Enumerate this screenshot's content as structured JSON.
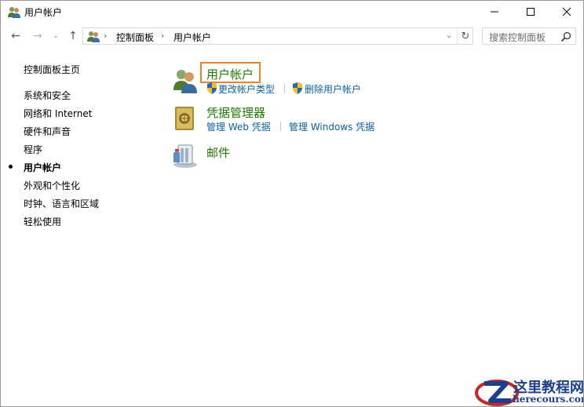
{
  "window": {
    "title": "用户帐户",
    "controls": {
      "minimize": "—",
      "maximize": "☐",
      "close": "✕"
    }
  },
  "nav": {
    "back": "←",
    "forward": "→",
    "recent": "⌄",
    "up": "↑"
  },
  "address": {
    "crumbs": [
      "控制面板",
      "用户帐户"
    ],
    "separator": "›",
    "dropdown": "⌄",
    "refresh": "↻"
  },
  "search": {
    "placeholder": "搜索控制面板"
  },
  "sidebar": {
    "home": "控制面板主页",
    "items": [
      {
        "label": "系统和安全"
      },
      {
        "label": "网络和 Internet"
      },
      {
        "label": "硬件和声音"
      },
      {
        "label": "程序"
      },
      {
        "label": "用户帐户",
        "active": true
      },
      {
        "label": "外观和个性化"
      },
      {
        "label": "时钟、语言和区域"
      },
      {
        "label": "轻松使用"
      }
    ]
  },
  "main": {
    "categories": [
      {
        "title": "用户帐户",
        "icon": "users-icon",
        "links": [
          "更改帐户类型",
          "删除用户帐户"
        ]
      },
      {
        "title": "凭据管理器",
        "icon": "vault-icon",
        "links": [
          "管理 Web 凭据",
          "管理 Windows 凭据"
        ]
      },
      {
        "title": "邮件",
        "icon": "mail-icon",
        "links": []
      }
    ]
  },
  "watermark": {
    "name": "这里教程网",
    "url": "herecours.com"
  },
  "colors": {
    "category_title": "#1e7a00",
    "link": "#0a60a8",
    "highlight": "#e8822e"
  }
}
